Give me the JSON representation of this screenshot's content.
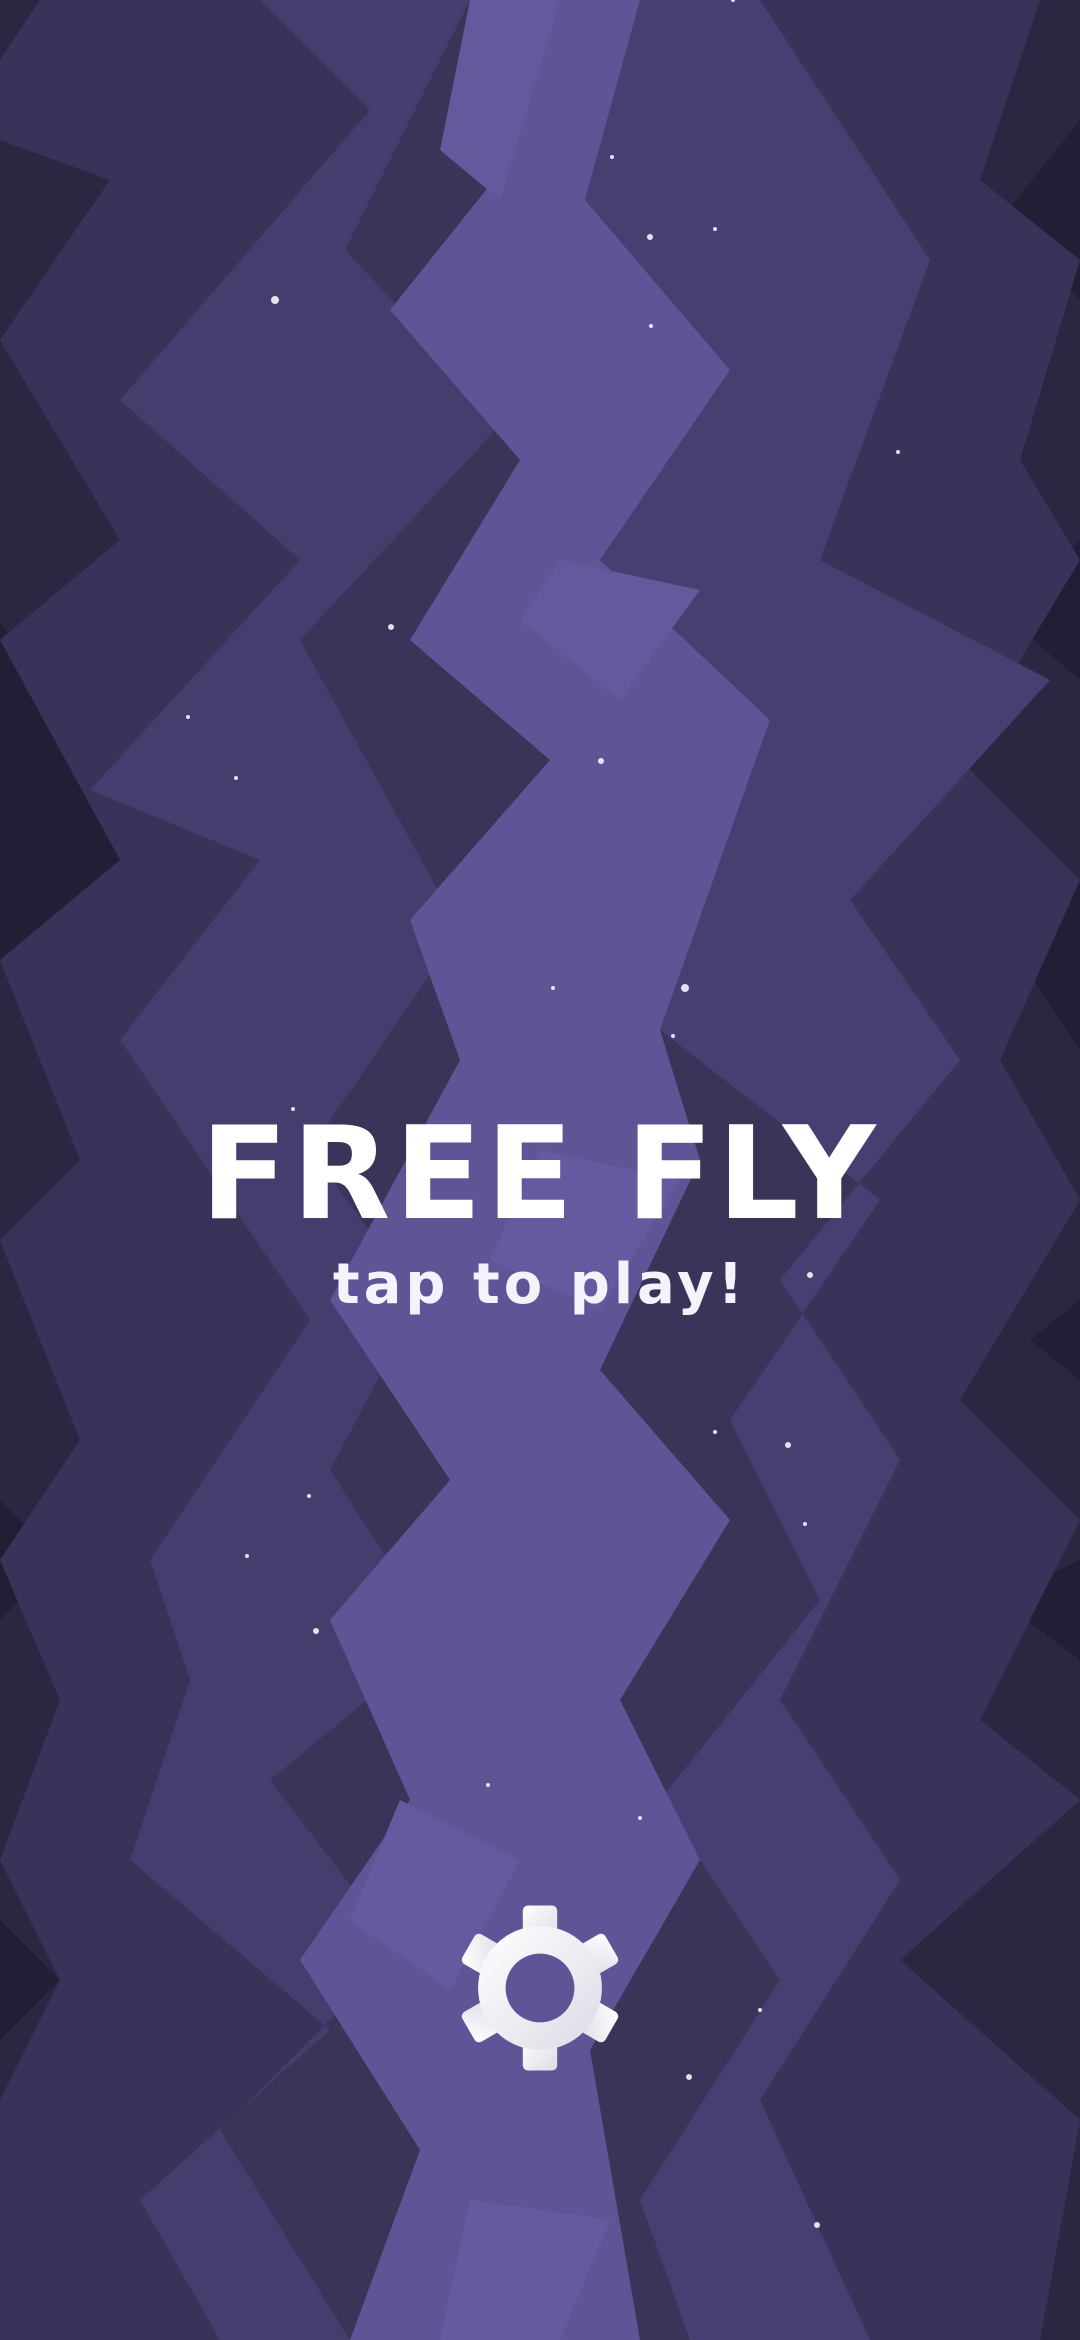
{
  "game": {
    "title": "FREE FLY",
    "subtitle": "tap to play!"
  },
  "icons": {
    "settings": "gear-icon"
  },
  "colors": {
    "background_dark": "#2a2540",
    "background_mid": "#3d3560",
    "background_light": "#4a3f75",
    "canyon_path": "#62579a",
    "text": "#ffffff",
    "gear": "#eeeef4"
  }
}
